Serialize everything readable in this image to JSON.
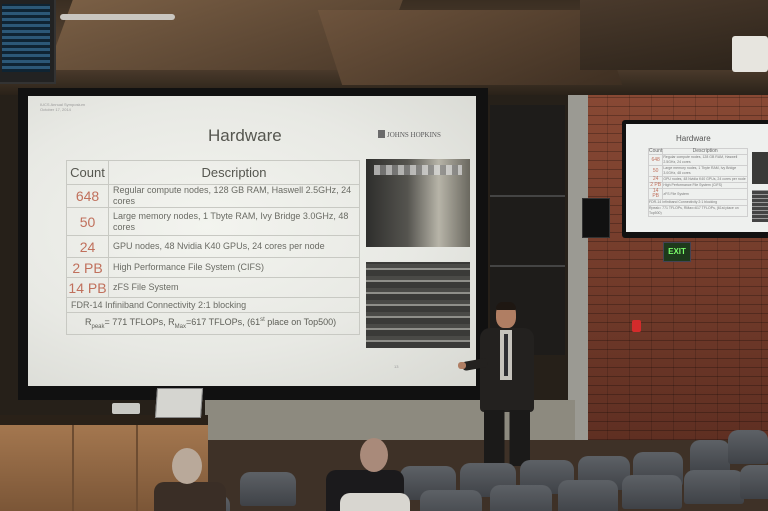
{
  "slide": {
    "header_small": "IUCS Annual Symposium\nOctober 17, 2014",
    "title": "Hardware",
    "logo_text": "JOHNS HOPKINS",
    "table_headers": {
      "count": "Count",
      "description": "Description"
    },
    "rows": [
      {
        "count": "648",
        "description": "Regular compute nodes, 128 GB RAM, Haswell 2.5GHz, 24 cores"
      },
      {
        "count": "50",
        "description": "Large memory nodes, 1 Tbyte RAM, Ivy Bridge 3.0GHz, 48 cores"
      },
      {
        "count": "24",
        "description": "GPU nodes, 48 Nvidia K40 GPUs, 24 cores per node"
      },
      {
        "count": "2 PB",
        "description": "High Performance File System   (CIFS)"
      },
      {
        "count": "14 PB",
        "description": "zFS File System"
      }
    ],
    "full_row_1": "FDR-14 Infiniband Connectivity  2:1 blocking",
    "rpeak_label": "R",
    "rpeak_sub": "peak",
    "rpeak_value": "= 771 TFLOPs, R",
    "rmax_sub": "Max",
    "rmax_value": "=617 TFLOPs, (61",
    "rank_sup": "st",
    "rank_rest": " place on Top500)",
    "page_number": "13"
  },
  "tv": {
    "title": "Hardware",
    "header_count": "Count",
    "header_desc": "Description",
    "rows": [
      {
        "count": "648",
        "description": "Regular compute nodes, 128 GB RAM, Haswell 2.5GHz, 24 cores"
      },
      {
        "count": "50",
        "description": "Large memory nodes, 1 Tbyte RAM, Ivy Bridge 3.0GHz, 48 cores"
      },
      {
        "count": "24",
        "description": "GPU nodes, 48 Nvidia K40 GPUs, 24 cores per node"
      },
      {
        "count": "2 PB",
        "description": "High Performance File System   (CIFS)"
      },
      {
        "count": "14 PB",
        "description": "zFS File System"
      }
    ],
    "footer1": "FDR-14 Infiniband Connectivity  2:1 blocking",
    "footer2": "Rpeak= 771 TFLOPs, RMax=617 TFLOPs, (61st place on Top500)"
  },
  "exit_sign": "EXIT",
  "colors": {
    "count_accent": "#c0705c",
    "slide_background": "#eeefe9",
    "brick": "#7a3d2c"
  }
}
